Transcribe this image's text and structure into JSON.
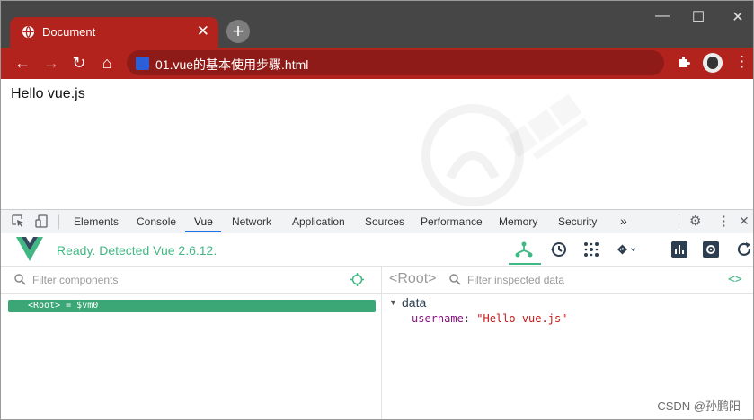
{
  "browser": {
    "tab_title": "Document",
    "tab_close": "✕",
    "new_tab": "+",
    "window_controls": {
      "minimize": "—",
      "maximize": "☐",
      "close": "✕"
    },
    "nav": {
      "back": "←",
      "forward": "→",
      "reload": "↻",
      "home": "⌂"
    },
    "url": "01.vue的基本使用步骤.html",
    "extensions_icon": "puzzle-icon",
    "menu": "⋮"
  },
  "page": {
    "content": "Hello vue.js"
  },
  "devtools": {
    "tabs": [
      "Elements",
      "Console",
      "Vue",
      "Network",
      "Application",
      "Sources",
      "Performance",
      "Memory",
      "Security"
    ],
    "active_tab": "Vue",
    "more_tabs": "»",
    "settings": "⚙",
    "kebab": "⋮",
    "close": "✕"
  },
  "vue": {
    "status": "Ready. Detected Vue 2.6.12.",
    "accent_color": "#41b883",
    "components": {
      "filter_placeholder": "Filter components",
      "root_row": "<Root> = $vm0"
    },
    "inspector": {
      "selected": "<Root>",
      "filter_placeholder": "Filter inspected data",
      "code_toggle": "<>",
      "section": "data",
      "props": [
        {
          "key": "username",
          "value": "\"Hello vue.js\""
        }
      ]
    }
  },
  "watermark_footer": "CSDN @孙鹏阳"
}
